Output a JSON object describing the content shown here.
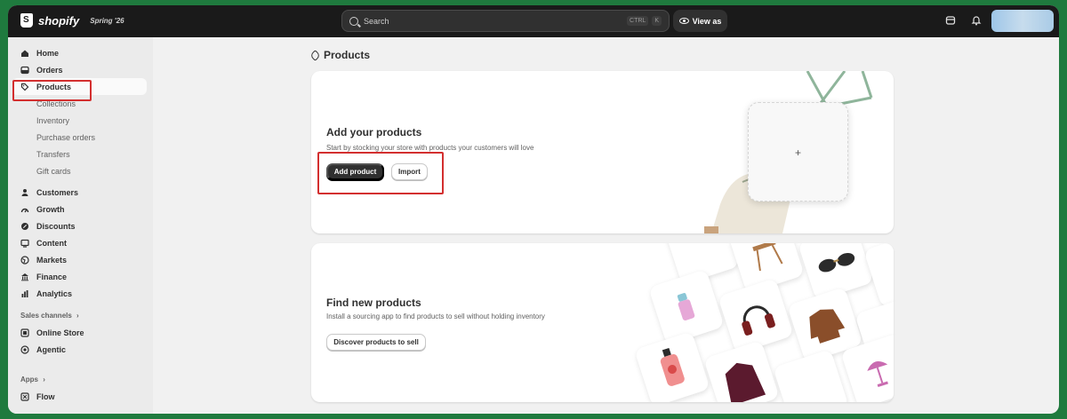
{
  "topbar": {
    "logo_text": "shopify",
    "edition": "Spring '26",
    "search_placeholder": "Search",
    "kbd_ctrl": "CTRL",
    "kbd_k": "K",
    "view_as": "View as"
  },
  "sidebar": {
    "main_items": [
      {
        "label": "Home",
        "icon": "home-icon"
      },
      {
        "label": "Orders",
        "icon": "inbox-icon"
      },
      {
        "label": "Products",
        "icon": "tag-icon"
      }
    ],
    "product_subitems": [
      "Collections",
      "Inventory",
      "Purchase orders",
      "Transfers",
      "Gift cards"
    ],
    "more_items": [
      {
        "label": "Customers",
        "icon": "person-icon"
      },
      {
        "label": "Growth",
        "icon": "gauge-icon"
      },
      {
        "label": "Discounts",
        "icon": "discount-icon"
      },
      {
        "label": "Content",
        "icon": "content-icon"
      },
      {
        "label": "Markets",
        "icon": "globe-icon"
      },
      {
        "label": "Finance",
        "icon": "bank-icon"
      },
      {
        "label": "Analytics",
        "icon": "chart-icon"
      }
    ],
    "sales_channels_label": "Sales channels",
    "sales_channels": [
      {
        "label": "Online Store",
        "icon": "store-icon"
      },
      {
        "label": "Agentic",
        "icon": "target-icon"
      }
    ],
    "apps_label": "Apps",
    "apps": [
      {
        "label": "Flow",
        "icon": "flow-icon"
      }
    ]
  },
  "main": {
    "page_title": "Products",
    "add_card": {
      "title": "Add your products",
      "description": "Start by stocking your store with products your customers will love",
      "primary_button": "Add product",
      "secondary_button": "Import",
      "upload_plus": "+"
    },
    "find_card": {
      "title": "Find new products",
      "description": "Install a sourcing app to find products to sell without holding inventory",
      "button": "Discover products to sell"
    }
  },
  "colors": {
    "background_green": "#1f7a3e",
    "topbar": "#1a1a1a",
    "highlight_red": "#d32f2f",
    "button_dark": "#303030"
  }
}
